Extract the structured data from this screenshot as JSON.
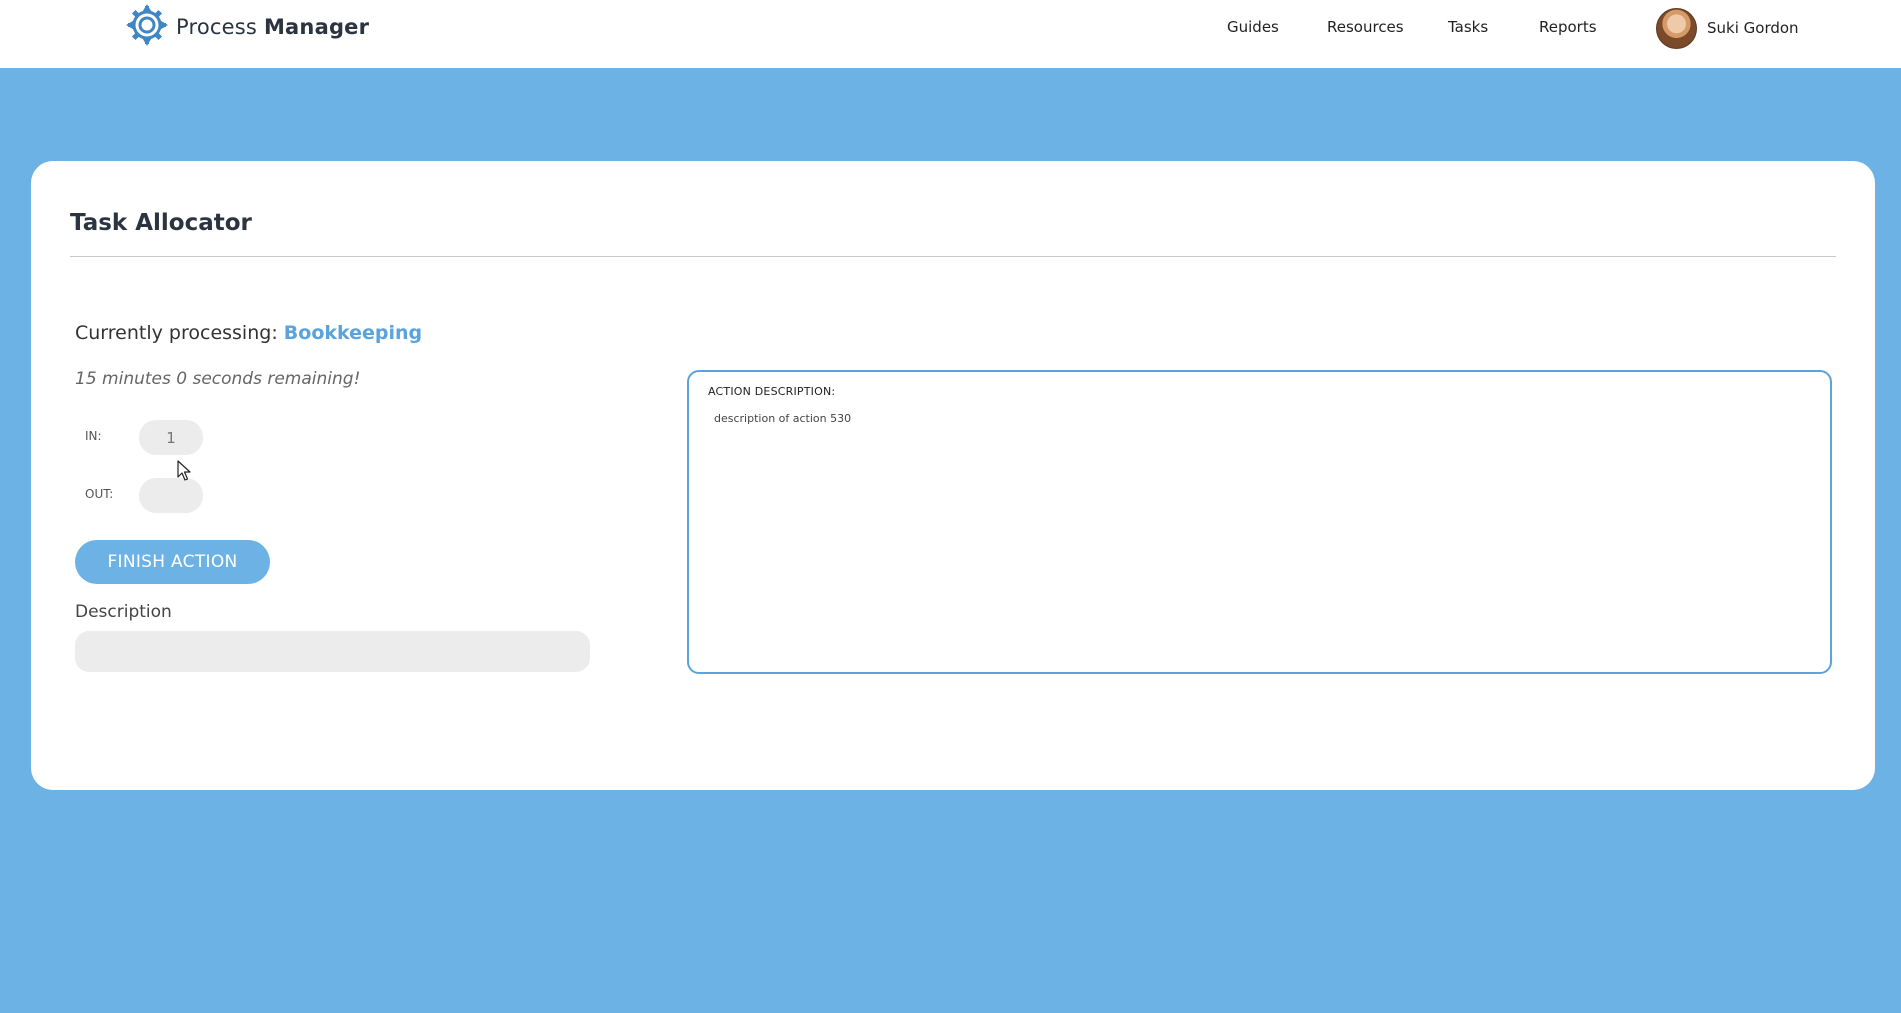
{
  "app": {
    "brand_prefix": "Process ",
    "brand_bold": "Manager",
    "logo_icon": "gear-icon"
  },
  "nav": {
    "items": [
      {
        "label": "Guides"
      },
      {
        "label": "Resources"
      },
      {
        "label": "Tasks"
      },
      {
        "label": "Reports"
      }
    ],
    "user_name": "Suki Gordon"
  },
  "page": {
    "title": "Task Allocator",
    "processing_label": "Currently processing:",
    "processing_task": "Bookkeeping",
    "remaining": "15 minutes 0 seconds remaining!",
    "in_label": "IN:",
    "in_value": "1",
    "out_label": "OUT:",
    "out_value": "",
    "finish_button": "FINISH ACTION",
    "description_label": "Description",
    "description_value": ""
  },
  "action": {
    "heading": "ACTION DESCRIPTION:",
    "text": "description of action 530"
  },
  "colors": {
    "background": "#6cb2e5",
    "accent": "#5aa3dc",
    "header": "#ffffff"
  }
}
